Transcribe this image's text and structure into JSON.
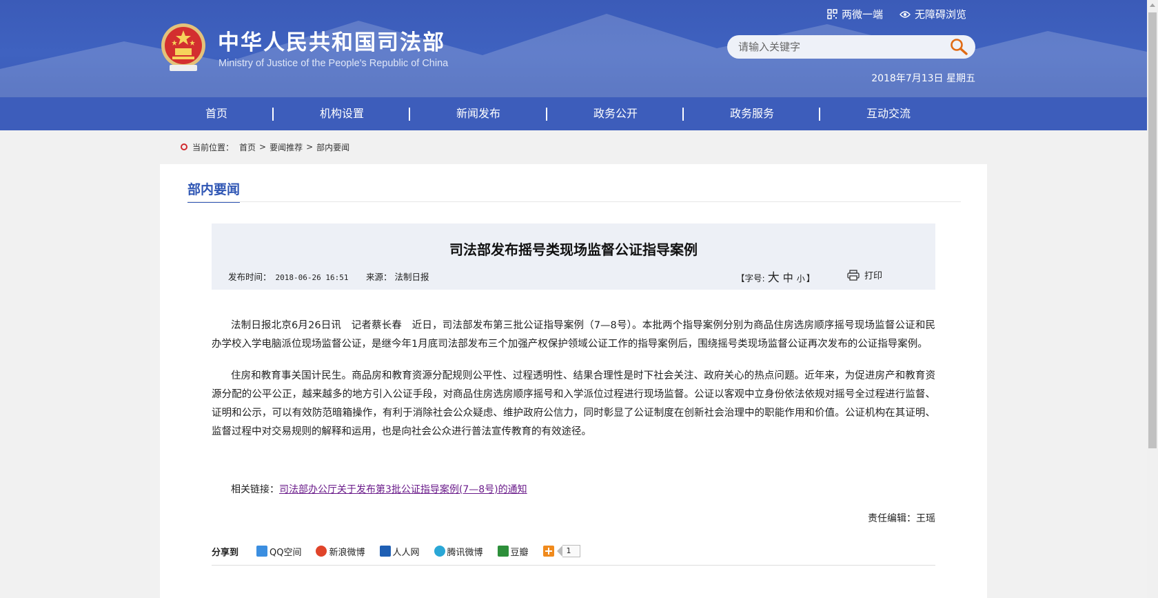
{
  "header": {
    "title": "中华人民共和国司法部",
    "subtitle": "Ministry of Justice of the People's Republic of China",
    "top_links": [
      {
        "label": "两微一端",
        "icon": "qr-code-icon"
      },
      {
        "label": "无障碍浏览",
        "icon": "eye-icon"
      }
    ],
    "search_placeholder": "请输入关键字",
    "date": "2018年7月13日 星期五"
  },
  "nav": {
    "items": [
      "首页",
      "机构设置",
      "新闻发布",
      "政务公开",
      "政务服务",
      "互动交流"
    ]
  },
  "breadcrumb": {
    "prefix": "当前位置：",
    "items": [
      "首页",
      "要闻推荐",
      "部内要闻"
    ],
    "separator": ">"
  },
  "section_heading": "部内要闻",
  "article": {
    "title": "司法部发布摇号类现场监督公证指导案例",
    "time_label": "发布时间：",
    "time_value": "2018-06-26 16:51",
    "source_label": "来源：",
    "source_value": "法制日报",
    "font_size_label": "【字号:",
    "font_size_big": "大",
    "font_size_mid": "中",
    "font_size_small": "小",
    "font_size_close": "】",
    "print_label": "打印",
    "paragraphs": [
      "法制日报北京6月26日讯　记者蔡长春　近日，司法部发布第三批公证指导案例（7—8号）。本批两个指导案例分别为商品住房选房顺序摇号现场监督公证和民办学校入学电脑派位现场监督公证，是继今年1月底司法部发布三个加强产权保护领域公证工作的指导案例后，围绕摇号类现场监督公证再次发布的公证指导案例。",
      "住房和教育事关国计民生。商品房和教育资源分配规则公平性、过程透明性、结果合理性是时下社会关注、政府关心的热点问题。近年来，为促进房产和教育资源分配的公平公正，越来越多的地方引入公证手段，对商品住房选房顺序摇号和入学派位过程进行现场监督。公证以客观中立身份依法依规对摇号全过程进行监督、证明和公示，可以有效防范暗箱操作，有利于消除社会公众疑虑、维护政府公信力，同时彰显了公证制度在创新社会治理中的职能作用和价值。公证机构在其证明、监督过程中对交易规则的解释和运用，也是向社会公众进行普法宣传教育的有效途径。"
    ],
    "related_label": "相关链接：",
    "related_link": "司法部办公厅关于发布第3批公证指导案例(7—8号)的通知",
    "editor": "责任编辑：王瑶"
  },
  "share": {
    "label": "分享到",
    "items": [
      {
        "label": "QQ空间",
        "icon": "qzone-icon",
        "color": "#3b8ee0"
      },
      {
        "label": "新浪微博",
        "icon": "weibo-icon",
        "color": "#e0442a"
      },
      {
        "label": "人人网",
        "icon": "renren-icon",
        "color": "#1f5fb4"
      },
      {
        "label": "腾讯微博",
        "icon": "tencent-weibo-icon",
        "color": "#2aa7d6"
      },
      {
        "label": "豆瓣",
        "icon": "douban-icon",
        "color": "#2d8f3a"
      }
    ],
    "count": "1"
  },
  "colors": {
    "header_blue": "#3d5dbb",
    "accent_blue": "#2f56b4",
    "link_purple": "#6a1b8a"
  }
}
